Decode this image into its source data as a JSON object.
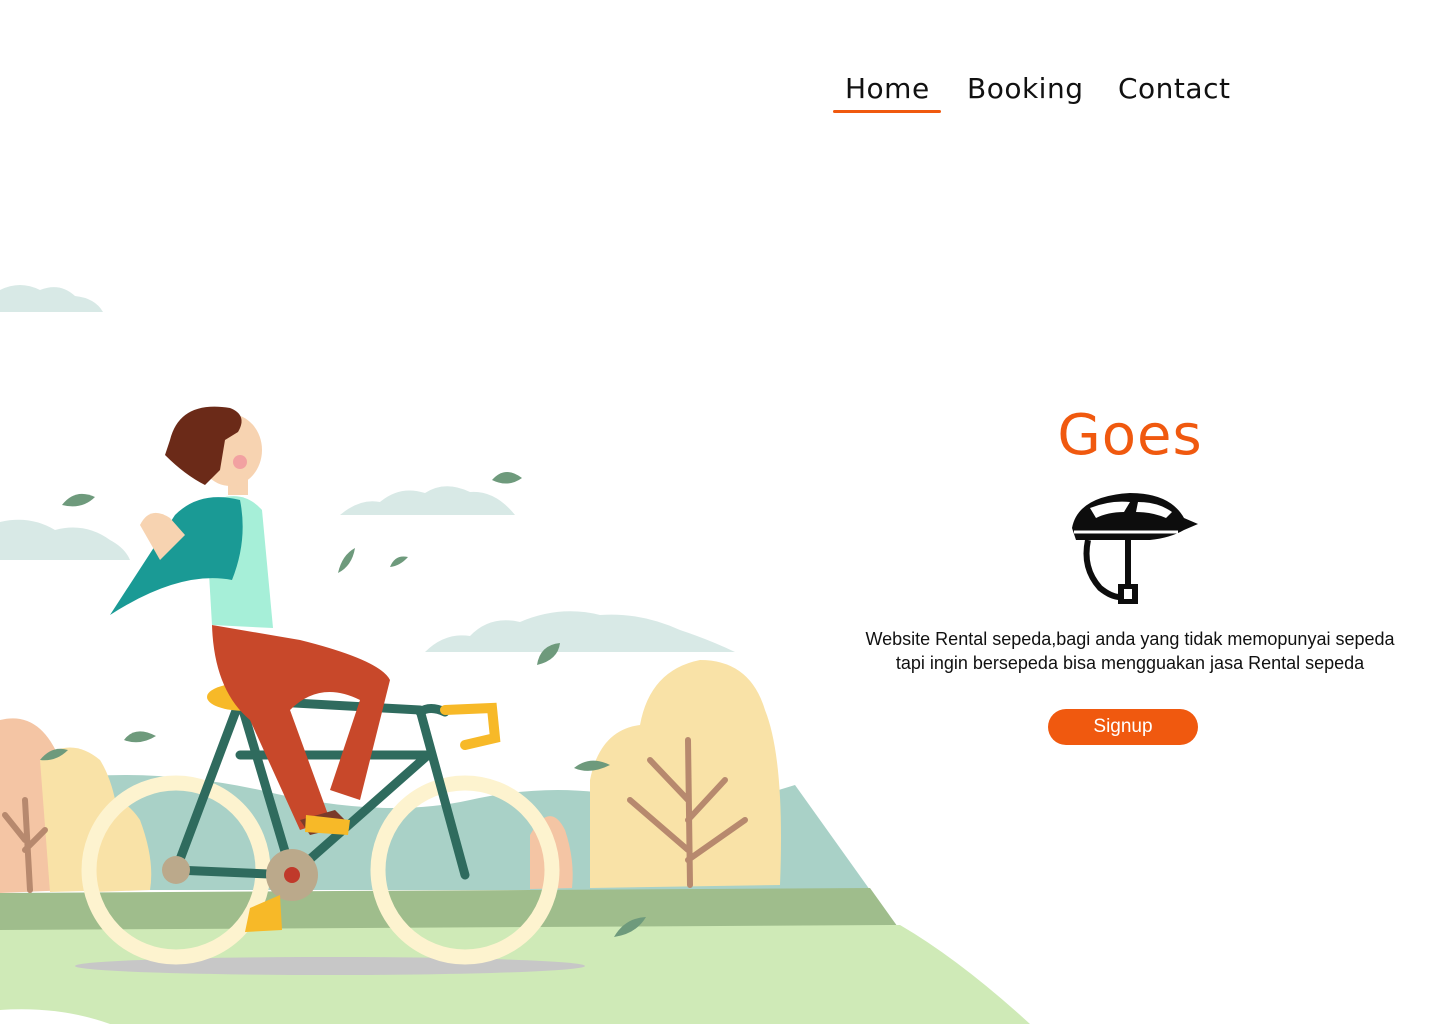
{
  "nav": {
    "items": [
      {
        "label": "Home",
        "active": true
      },
      {
        "label": "Booking",
        "active": false
      },
      {
        "label": "Contact",
        "active": false
      }
    ],
    "active_color": "#f0590f"
  },
  "hero": {
    "title": "Goes",
    "icon": "bike-helmet-icon",
    "description": "Website Rental sepeda,bagi anda yang tidak memopunyai sepeda tapi ingin bersepeda bisa mengguakan jasa Rental sepeda",
    "signup_label": "Signup"
  },
  "illustration": {
    "subject": "person-riding-bicycle-illustration"
  },
  "colors": {
    "accent": "#f0590f",
    "text": "#111111",
    "background": "#ffffff"
  }
}
